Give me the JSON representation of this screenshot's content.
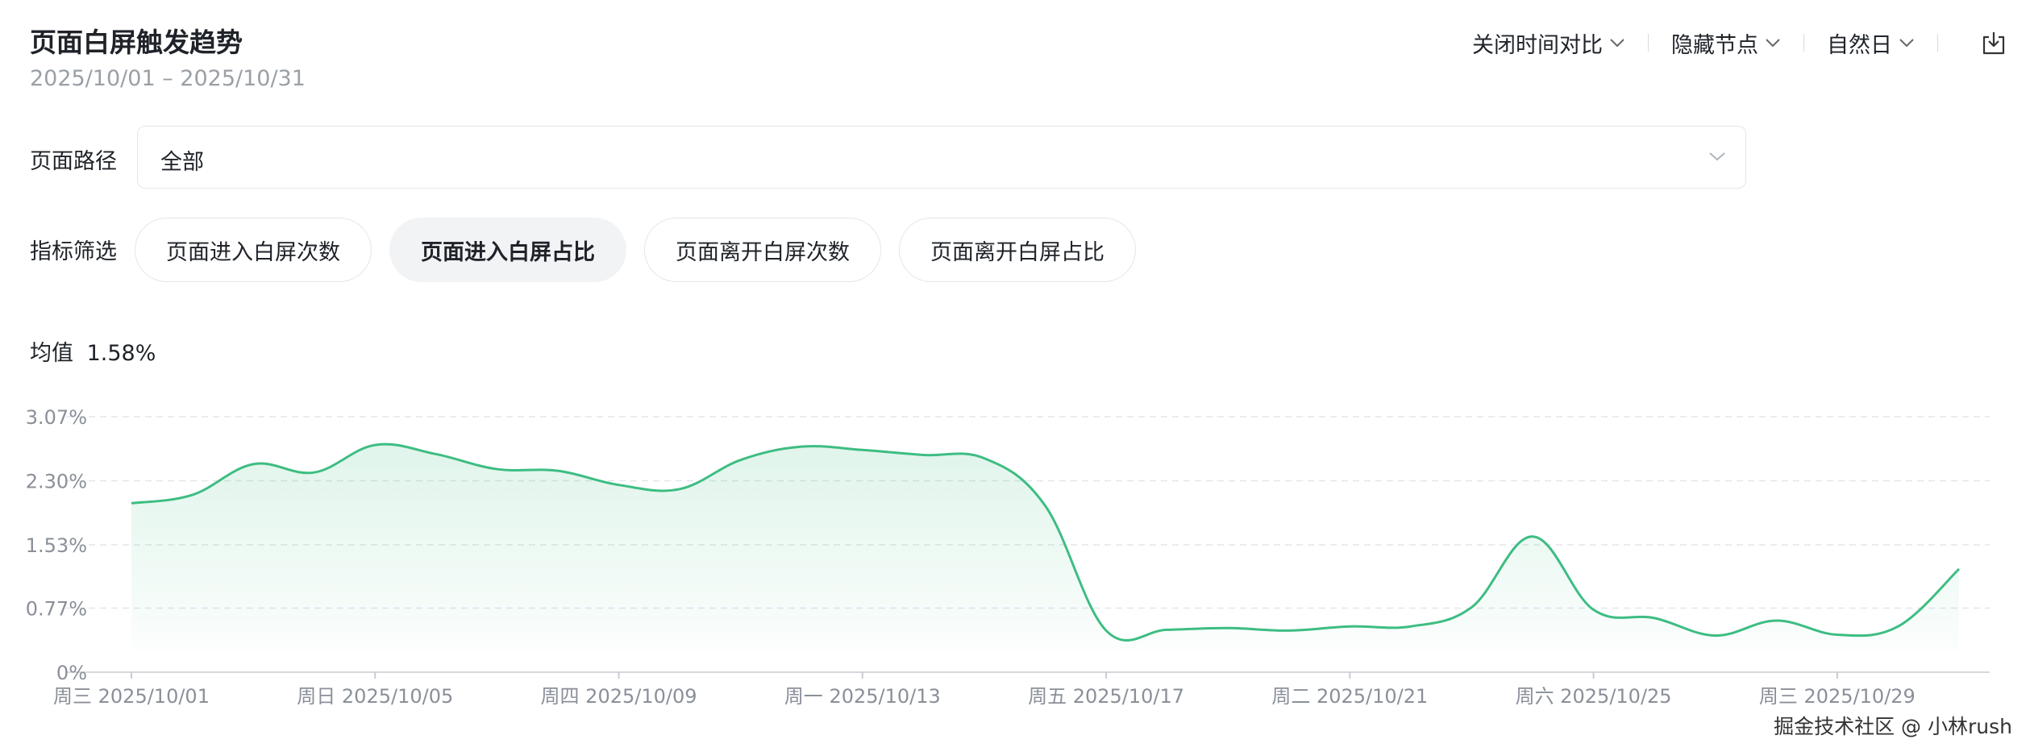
{
  "header": {
    "title": "页面白屏触发趋势",
    "date_range": "2025/10/01 – 2025/10/31"
  },
  "toolbar": {
    "compare_label": "关闭时间对比",
    "nodes_label": "隐藏节点",
    "granularity_label": "自然日",
    "export_icon": "export-icon"
  },
  "filters": {
    "path_label": "页面路径",
    "path_value": "全部",
    "metric_label": "指标筛选",
    "metrics": [
      {
        "label": "页面进入白屏次数",
        "active": false
      },
      {
        "label": "页面进入白屏占比",
        "active": true
      },
      {
        "label": "页面离开白屏次数",
        "active": false
      },
      {
        "label": "页面离开白屏占比",
        "active": false
      }
    ]
  },
  "summary": {
    "avg_label": "均值",
    "avg_value": "1.58%"
  },
  "colors": {
    "line": "#3dbd82",
    "grid": "#e3e6ea",
    "axis_text": "#8a8f99"
  },
  "chart_data": {
    "type": "area",
    "x": [
      "2025/10/01",
      "2025/10/02",
      "2025/10/03",
      "2025/10/04",
      "2025/10/05",
      "2025/10/06",
      "2025/10/07",
      "2025/10/08",
      "2025/10/09",
      "2025/10/10",
      "2025/10/11",
      "2025/10/12",
      "2025/10/13",
      "2025/10/14",
      "2025/10/15",
      "2025/10/16",
      "2025/10/17",
      "2025/10/18",
      "2025/10/19",
      "2025/10/20",
      "2025/10/21",
      "2025/10/22",
      "2025/10/23",
      "2025/10/24",
      "2025/10/25",
      "2025/10/26",
      "2025/10/27",
      "2025/10/28",
      "2025/10/29",
      "2025/10/30",
      "2025/10/31"
    ],
    "y_values": [
      2.03,
      2.13,
      2.5,
      2.4,
      2.73,
      2.62,
      2.44,
      2.42,
      2.25,
      2.2,
      2.55,
      2.71,
      2.67,
      2.61,
      2.57,
      2.0,
      0.5,
      0.51,
      0.53,
      0.5,
      0.55,
      0.55,
      0.78,
      1.63,
      0.75,
      0.65,
      0.44,
      0.62,
      0.45,
      0.55,
      1.24
    ],
    "y_unit": "%",
    "ylim": [
      0,
      3.07
    ],
    "y_ticks": [
      "0%",
      "0.77%",
      "1.53%",
      "2.30%",
      "3.07%"
    ],
    "y_tick_values": [
      0,
      0.77,
      1.53,
      2.3,
      3.07
    ],
    "x_tick_labels": [
      "周三 2025/10/01",
      "周日 2025/10/05",
      "周四 2025/10/09",
      "周一 2025/10/13",
      "周五 2025/10/17",
      "周二 2025/10/21",
      "周六 2025/10/25",
      "周三 2025/10/29"
    ],
    "x_tick_index": [
      0,
      4,
      8,
      12,
      16,
      20,
      24,
      28
    ],
    "grid": true
  },
  "watermark": "掘金技术社区 @ 小林rush"
}
